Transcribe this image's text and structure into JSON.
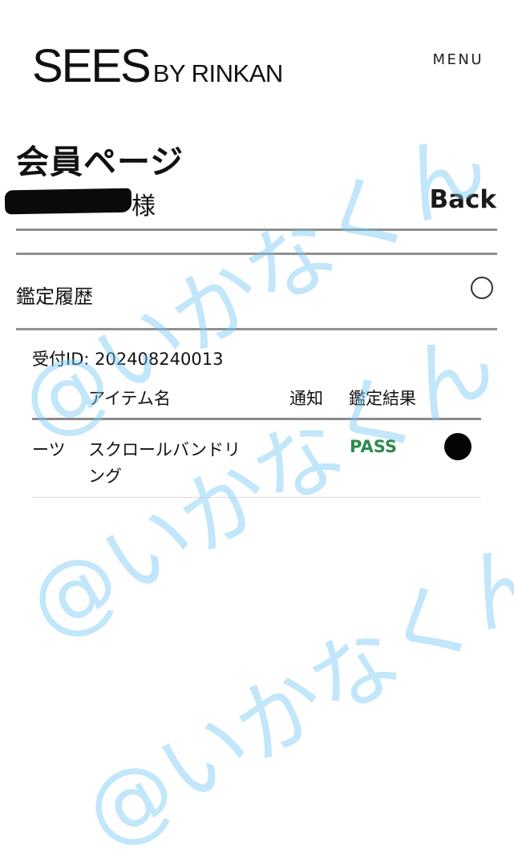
{
  "header": {
    "brand": "SEES",
    "brand_sub": "BY RINKAN",
    "menu_label": "MENU"
  },
  "page": {
    "title": "会員ページ",
    "user_suffix": "様",
    "back_label": "Back"
  },
  "section": {
    "title": "鑑定履歴"
  },
  "receipt": {
    "label": "受付ID: 202408240013"
  },
  "table": {
    "headers": {
      "item_name": "アイテム名",
      "notify": "通知",
      "result": "鑑定結果"
    },
    "rows": [
      {
        "category": "ーツ",
        "item_line1": "スクロールバンドリ",
        "item_line2": "ング",
        "result": "PASS"
      }
    ]
  },
  "watermark": {
    "text": "@いかなくん"
  },
  "colors": {
    "pass": "#2e8b4a",
    "watermark": "#78c8f5",
    "divider": "#8f8f8f"
  }
}
